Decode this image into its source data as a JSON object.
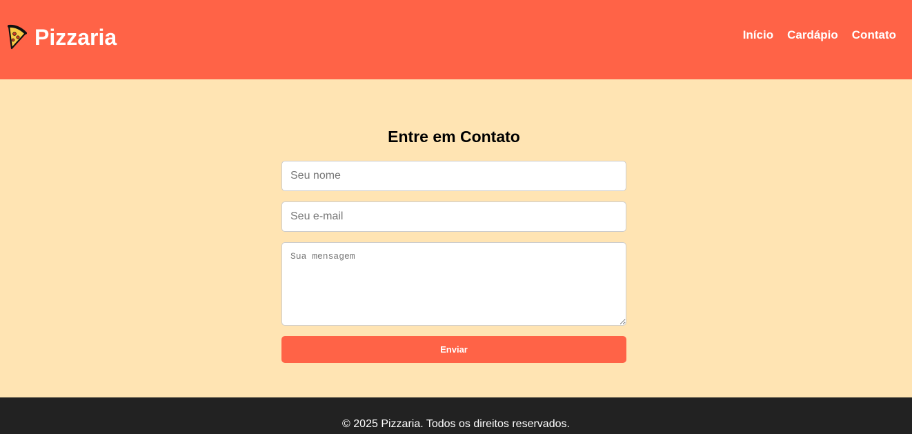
{
  "header": {
    "logo_icon": "pizza-slice-icon",
    "title": "Pizzaria",
    "nav": [
      {
        "label": "Início"
      },
      {
        "label": "Cardápio"
      },
      {
        "label": "Contato"
      }
    ]
  },
  "contact": {
    "title": "Entre em Contato",
    "name_placeholder": "Seu nome",
    "email_placeholder": "Seu e-mail",
    "message_placeholder": "Sua mensagem",
    "submit_label": "Enviar"
  },
  "footer": {
    "text": "© 2025 Pizzaria. Todos os direitos reservados."
  },
  "colors": {
    "primary": "#ff6347",
    "background": "#ffe4b3",
    "footer": "#222222",
    "text_on_primary": "#ffffff"
  }
}
